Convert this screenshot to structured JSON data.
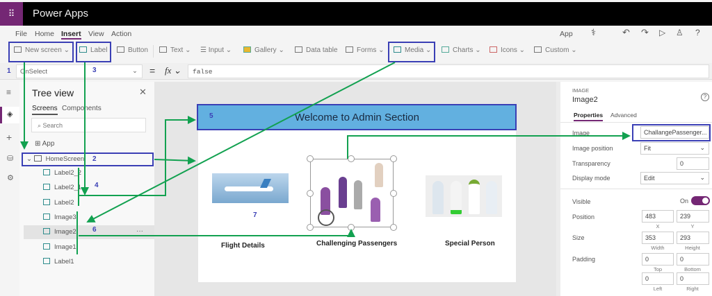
{
  "app": {
    "title": "Power Apps"
  },
  "menu": [
    "File",
    "Home",
    "Insert",
    "View",
    "Action"
  ],
  "menu_right": {
    "app_label": "App"
  },
  "toolbar": {
    "new_screen": "New screen",
    "label": "Label",
    "button": "Button",
    "text": "Text",
    "input": "Input",
    "gallery": "Gallery",
    "data_table": "Data table",
    "forms": "Forms",
    "media": "Media",
    "charts": "Charts",
    "icons": "Icons",
    "custom": "Custom"
  },
  "formula": {
    "property": "OnSelect",
    "fx": "fx",
    "value": "false"
  },
  "tree": {
    "title": "Tree view",
    "tabs": [
      "Screens",
      "Components"
    ],
    "search_placeholder": "Search",
    "app": "App",
    "screen": "HomeScreen",
    "items": [
      {
        "name": "Label2_2",
        "type": "label"
      },
      {
        "name": "Label2_1",
        "type": "label"
      },
      {
        "name": "Label2",
        "type": "label"
      },
      {
        "name": "Image3",
        "type": "image"
      },
      {
        "name": "Image2",
        "type": "image",
        "selected": true
      },
      {
        "name": "Image1",
        "type": "image"
      },
      {
        "name": "Label1",
        "type": "label"
      }
    ],
    "more": "···"
  },
  "canvas": {
    "header": "Welcome to Admin Section",
    "captions": [
      "Flight Details",
      "Challenging Passengers",
      "Special Person"
    ]
  },
  "props": {
    "type": "IMAGE",
    "name": "Image2",
    "help": "?",
    "tabs": [
      "Properties",
      "Advanced"
    ],
    "image_label": "Image",
    "image_value": "ChallangePassenger...",
    "position_label": "Image position",
    "position_value": "Fit",
    "transparency_label": "Transparency",
    "transparency_value": "0",
    "display_label": "Display mode",
    "display_value": "Edit",
    "visible_label": "Visible",
    "visible_value": "On",
    "pos_label": "Position",
    "x": "483",
    "y": "239",
    "x_label": "X",
    "y_label": "Y",
    "size_label": "Size",
    "width": "353",
    "height": "293",
    "w_label": "Width",
    "h_label": "Height",
    "padding_label": "Padding",
    "top": "0",
    "bottom": "0",
    "left": "0",
    "right": "0",
    "top_label": "Top",
    "bottom_label": "Bottom",
    "left_label": "Left",
    "right_label": "Right"
  },
  "annotations": [
    "1",
    "2",
    "3",
    "4",
    "5",
    "6",
    "7"
  ],
  "colors": {
    "brand": "#742774",
    "annotation_box": "#3a3fb5",
    "arrow": "#12a150",
    "header_bg": "#62b0e0"
  }
}
